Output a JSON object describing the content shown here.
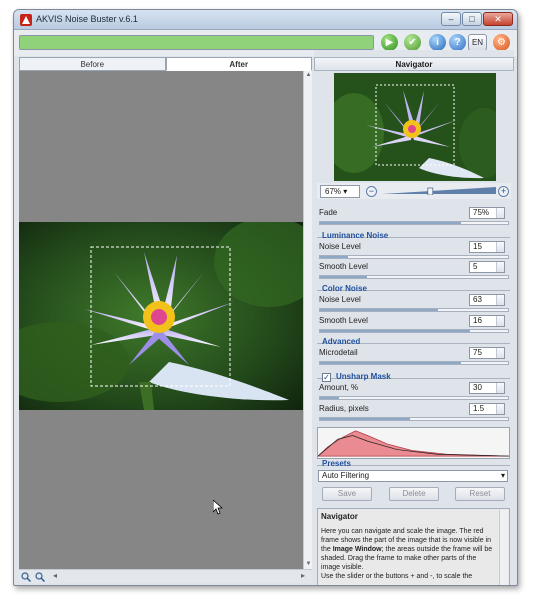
{
  "window": {
    "title": "AKVIS Noise Buster v.6.1",
    "controls": [
      "–",
      "□",
      "✕"
    ]
  },
  "toolbar": {
    "progress_value": 1,
    "lang_label": "EN"
  },
  "tabs": [
    {
      "label": "Before",
      "active": false
    },
    {
      "label": "After",
      "active": true
    }
  ],
  "navigator": {
    "title": "Navigator",
    "zoom_value": "67%",
    "zoom_slider_fraction": 0.42
  },
  "params": {
    "fade": {
      "label": "Fade",
      "value": "75%",
      "level": 0.75
    },
    "luminance": {
      "title": "Luminance Noise",
      "noise_level": {
        "label": "Noise Level",
        "value": "15",
        "level": 0.15
      },
      "smooth_level": {
        "label": "Smooth Level",
        "value": "5",
        "level": 0.25
      }
    },
    "color": {
      "title": "Color Noise",
      "noise_level": {
        "label": "Noise Level",
        "value": "63",
        "level": 0.63
      },
      "smooth_level": {
        "label": "Smooth Level",
        "value": "16",
        "level": 0.8
      }
    },
    "advanced": {
      "title": "Advanced",
      "microdetail": {
        "label": "Microdetail",
        "value": "75",
        "level": 0.75
      }
    },
    "unsharp": {
      "title": "Unsharp Mask",
      "checked": true,
      "amount": {
        "label": "Amount, %",
        "value": "30",
        "level": 0.1
      },
      "radius": {
        "label": "Radius, pixels",
        "value": "1.5",
        "level": 0.48
      }
    }
  },
  "presets": {
    "title": "Presets",
    "selected": "Auto Filtering",
    "save_label": "Save",
    "delete_label": "Delete",
    "reset_label": "Reset"
  },
  "help": {
    "title": "Navigator",
    "text_1": "Here you can navigate and scale the image. The red frame shows the part of the image that is now visible in the ",
    "text_bold": "Image Window",
    "text_2": "; the areas outside the frame will be shaded. Drag the frame to make other parts of the image visible.",
    "text_3": "Use the slider or the buttons + and -, to scale the"
  },
  "colors": {
    "accent_blue": "#1f4f9c",
    "canvas_gray": "#868686",
    "panel_bg": "#dfe4ea"
  },
  "icons": [
    "app-icon",
    "run-icon",
    "apply-icon",
    "info-icon",
    "help-icon",
    "preferences-icon",
    "zoom-in-icon",
    "zoom-out-icon",
    "cursor-icon"
  ]
}
